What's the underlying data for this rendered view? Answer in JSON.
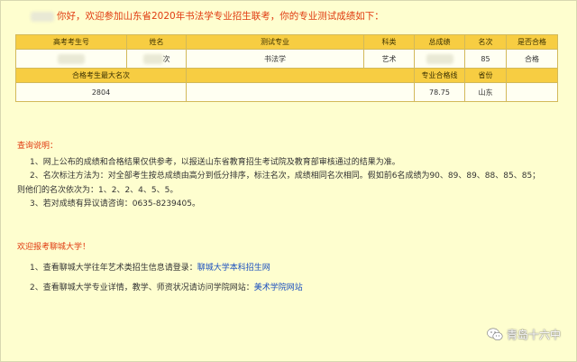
{
  "greeting": {
    "text": "你好，欢迎参加山东省2020年书法学专业招生联考，你的专业测试成绩如下："
  },
  "table": {
    "header1": [
      "高考考生号",
      "姓名",
      "测试专业",
      "科类",
      "总成绩",
      "名次",
      "是否合格"
    ],
    "row1": {
      "name_suffix": "次",
      "major": "书法学",
      "category": "艺术",
      "rank": "85",
      "qualified": "合格"
    },
    "header2": {
      "max_rank_label": "合格考生最大名次",
      "qual_line_label": "专业合格线",
      "province_label": "省份"
    },
    "row2": {
      "max_rank": "2804",
      "qual_line": "78.75",
      "province": "山东"
    }
  },
  "notes": {
    "title": "查询说明：",
    "line1": "1、网上公布的成绩和合格结果仅供参考，以报送山东省教育招生考试院及教育部审核通过的结果为准。",
    "line2": "2、名次标注方法为：对全部考生按总成绩由高分到低分排序，标注名次，成绩相同名次相同。假如前6名成绩为90、89、89、88、85、85；",
    "line2b": "则他们的名次依次为：1、2、2、4、5、5。",
    "line3": "3、若对成绩有异议请咨询：0635-8239405。"
  },
  "welcome": "欢迎报考聊城大学！",
  "links": {
    "item1_text": "1、查看聊城大学往年艺术类招生信息请登录：",
    "item1_link": "聊城大学本科招生网",
    "item2_text": "2、查看聊城大学专业详情，教学、师资状况请访问学院网站：",
    "item2_link": "美术学院网站"
  },
  "watermark": {
    "text": "青岛十六中",
    "icon": "wechat-icon"
  },
  "colors": {
    "background": "#fefecf",
    "header": "#f7cd42",
    "accent_red": "#e03a10",
    "link": "#1a4fbf"
  }
}
